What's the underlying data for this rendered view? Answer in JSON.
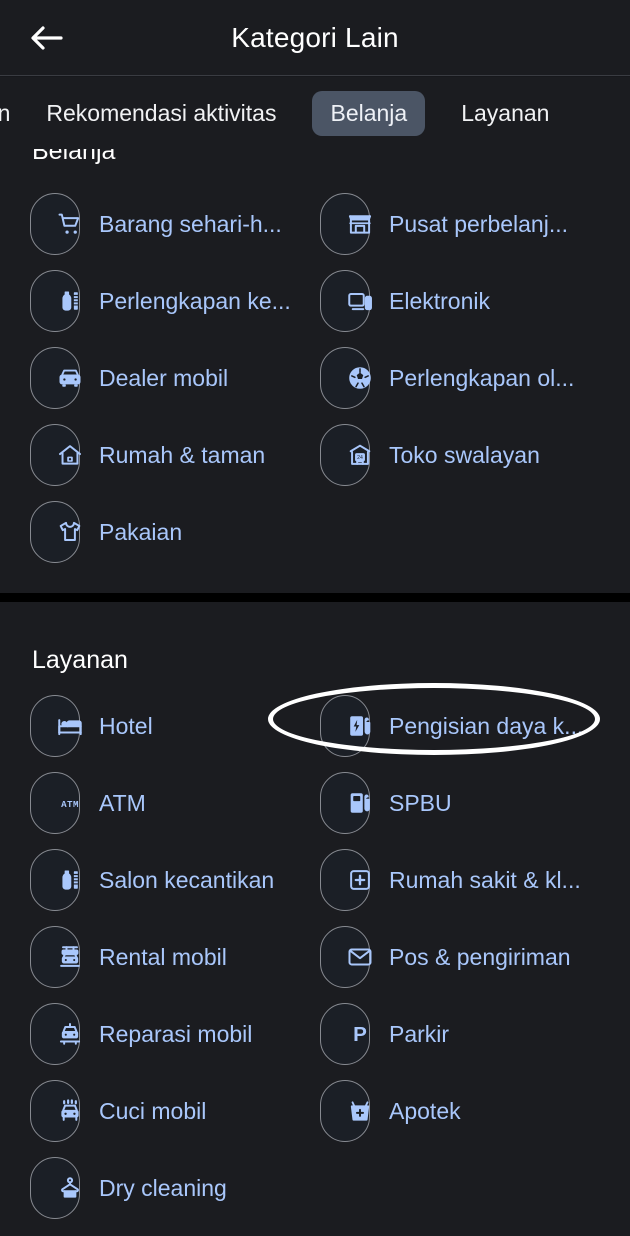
{
  "appbar": {
    "title": "Kategori Lain",
    "back_icon": "back-arrow-icon"
  },
  "tabs": [
    {
      "label": "nan",
      "active": false,
      "clipped": true
    },
    {
      "label": "Rekomendasi aktivitas",
      "active": false,
      "clipped": false
    },
    {
      "label": "Belanja",
      "active": true,
      "clipped": false
    },
    {
      "label": "Layanan",
      "active": false,
      "clipped": false
    }
  ],
  "sections": [
    {
      "title": "Belanja",
      "chips_left": [
        {
          "label": "Barang sehari-h...",
          "icon": "shopping-cart-icon"
        },
        {
          "label": "Perlengkapan ke...",
          "icon": "beauty-supply-icon"
        },
        {
          "label": "Dealer mobil",
          "icon": "car-front-icon"
        },
        {
          "label": "Rumah & taman",
          "icon": "home-garden-icon"
        },
        {
          "label": "Pakaian",
          "icon": "t-shirt-icon"
        }
      ],
      "chips_right": [
        {
          "label": "Pusat perbelanj...",
          "icon": "storefront-icon"
        },
        {
          "label": "Elektronik",
          "icon": "devices-icon"
        },
        {
          "label": "Perlengkapan ol...",
          "icon": "soccer-ball-icon"
        },
        {
          "label": "Toko swalayan",
          "icon": "convenience-store-icon"
        }
      ]
    },
    {
      "title": "Layanan",
      "chips_left": [
        {
          "label": "Hotel",
          "icon": "hotel-bed-icon"
        },
        {
          "label": "ATM",
          "icon": "atm-icon"
        },
        {
          "label": "Salon kecantikan",
          "icon": "beauty-salon-icon"
        },
        {
          "label": "Rental mobil",
          "icon": "car-rental-icon"
        },
        {
          "label": "Reparasi mobil",
          "icon": "car-repair-icon"
        },
        {
          "label": "Cuci mobil",
          "icon": "car-wash-icon"
        },
        {
          "label": "Dry cleaning",
          "icon": "dry-cleaning-icon"
        }
      ],
      "chips_right": [
        {
          "label": "Pengisian daya k...",
          "icon": "ev-charging-icon",
          "highlighted": true
        },
        {
          "label": "SPBU",
          "icon": "fuel-pump-icon"
        },
        {
          "label": "Rumah sakit & kl...",
          "icon": "hospital-icon"
        },
        {
          "label": "Pos & pengiriman",
          "icon": "mail-envelope-icon"
        },
        {
          "label": "Parkir",
          "icon": "parking-p-icon"
        },
        {
          "label": "Apotek",
          "icon": "pharmacy-icon"
        }
      ]
    }
  ],
  "colors": {
    "background": "#17181c",
    "surface": "#1b1c20",
    "chip_surface": "#1b1f26",
    "chip_border": "#878a91",
    "chip_text": "#a9c7fb",
    "title_text": "#ffffff",
    "active_tab_bg": "#4b5565",
    "divider": "#000000",
    "highlight_ring": "#ffffff"
  },
  "annotation": {
    "type": "ellipse-highlight",
    "target_label": "Pengisian daya k..."
  }
}
